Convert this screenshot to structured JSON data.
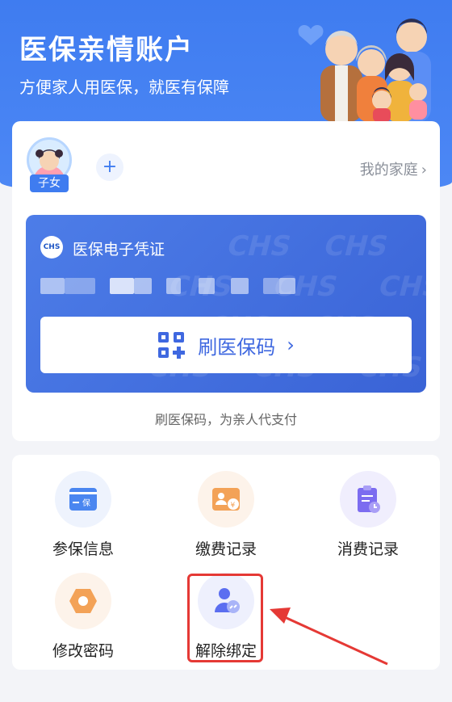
{
  "header": {
    "title": "医保亲情账户",
    "subtitle": "方便家人用医保，就医有保障"
  },
  "member": {
    "tag": "子女",
    "add_symbol": "+",
    "my_family_label": "我的家庭"
  },
  "certificate": {
    "logo_text": "CHS",
    "title": "医保电子凭证",
    "scan_button_label": "刷医保码",
    "caption": "刷医保码，为亲人代支付"
  },
  "tools": [
    {
      "label": "参保信息",
      "icon": "insurance-card-icon",
      "color": "#4a86f0"
    },
    {
      "label": "缴费记录",
      "icon": "payment-record-icon",
      "color": "#f3a257"
    },
    {
      "label": "消费记录",
      "icon": "consumption-record-icon",
      "color": "#7c6cf0"
    },
    {
      "label": "修改密码",
      "icon": "change-password-icon",
      "color": "#f3a257"
    },
    {
      "label": "解除绑定",
      "icon": "unbind-icon",
      "color": "#5b6ef0"
    }
  ],
  "colors": {
    "primary": "#3f7cf0",
    "highlight": "#e53935"
  }
}
